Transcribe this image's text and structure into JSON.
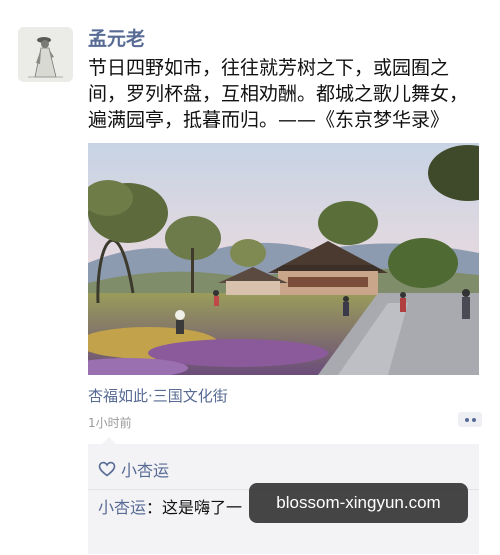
{
  "post": {
    "author": "孟元老",
    "text": "节日四野如市，往往就芳树之下，或园囿之间，罗列杯盘，互相劝酬。都城之歌儿舞女，遍满园亭，抵暮而归。——《东京梦华录》",
    "location": "杏福如此·三国文化街",
    "time": "1小时前",
    "avatar_icon": "scholar-portrait",
    "image_icon": "landscape-rendering"
  },
  "likes": {
    "icon": "heart-outline-icon",
    "names": [
      "小杏运"
    ]
  },
  "comments": [
    {
      "author": "小杏运",
      "separator": "：",
      "text": "这是嗨了一"
    }
  ],
  "watermark": {
    "text": "blossom-xingyun.com"
  },
  "colors": {
    "link": "#576b95",
    "text": "#111111",
    "meta": "#9a9a9a",
    "comment_bg": "#f3f3f5"
  }
}
